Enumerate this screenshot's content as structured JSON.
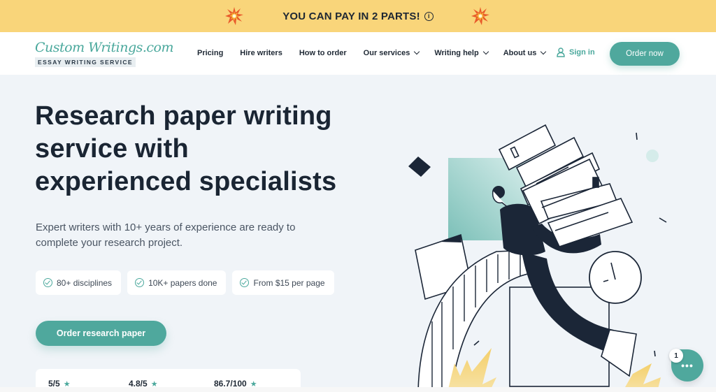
{
  "promo": {
    "text": "YOU CAN PAY IN 2 PARTS!",
    "info_glyph": "i",
    "decor_icon": "explosion-burst-icon",
    "background": "#f9d57a"
  },
  "header": {
    "logo_script": "Custom Writings.com",
    "logo_tagline": "ESSAY WRITING SERVICE",
    "nav": [
      {
        "label": "Pricing",
        "dropdown": false
      },
      {
        "label": "Hire writers",
        "dropdown": false
      },
      {
        "label": "How to order",
        "dropdown": false
      },
      {
        "label": "Our services",
        "dropdown": true
      },
      {
        "label": "Writing help",
        "dropdown": true
      },
      {
        "label": "About us",
        "dropdown": true
      }
    ],
    "signin_label": "Sign in",
    "order_label": "Order now",
    "accent": "#4fa89d"
  },
  "hero": {
    "title_lines": [
      "Research paper writing",
      "service with",
      "experienced specialists"
    ],
    "subtitle": "Expert writers with 10+ years of experience are ready to complete your research project.",
    "chips": [
      {
        "label": "80+ disciplines",
        "icon": "check-circle-icon"
      },
      {
        "label": "10K+ papers done",
        "icon": "check-circle-icon"
      },
      {
        "label": "From $15 per page",
        "icon": "check-circle-icon"
      }
    ],
    "cta_label": "Order research paper"
  },
  "ratings": [
    {
      "value": "5/5",
      "icon": "star-icon"
    },
    {
      "value": "4.8/5",
      "icon": "star-icon"
    },
    {
      "value": "86.7/100",
      "icon": "star-icon"
    }
  ],
  "chat": {
    "badge_count": "1",
    "glyph": "•••"
  }
}
